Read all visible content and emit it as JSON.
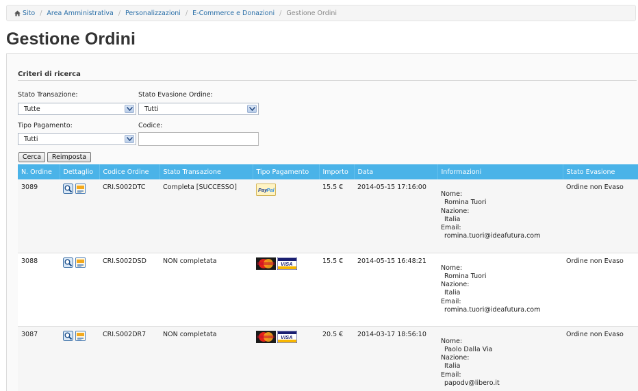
{
  "breadcrumb": {
    "items": [
      "Sito",
      "Area Amministrativa",
      "Personalizzazioni",
      "E-Commerce e Donazioni"
    ],
    "current": "Gestione Ordini"
  },
  "page": {
    "title": "Gestione Ordini"
  },
  "search": {
    "title": "Criteri di ricerca",
    "stato_transazione": {
      "label": "Stato Transazione:",
      "value": "Tutte"
    },
    "stato_evasione": {
      "label": "Stato Evasione Ordine:",
      "value": "Tutti"
    },
    "tipo_pagamento": {
      "label": "Tipo Pagamento:",
      "value": "Tutti"
    },
    "codice": {
      "label": "Codice:",
      "value": ""
    },
    "cerca_label": "Cerca",
    "reimposta_label": "Reimposta"
  },
  "table": {
    "headers": [
      "N. Ordine",
      "Dettaglio",
      "Codice Ordine",
      "Stato Transazione",
      "Tipo Pagamento",
      "Importo",
      "Data",
      "Informazioni",
      "Stato Evasione"
    ],
    "info_labels": {
      "nome": "Nome:",
      "nazione": "Nazione:",
      "email": "Email:"
    },
    "rows": [
      {
        "numero": "3089",
        "codice": "CRI.S002DTC",
        "stato": "Completa [SUCCESSO]",
        "pagamento": "paypal",
        "importo": "15.5 €",
        "data": "2014-05-15 17:16:00",
        "nome": "Romina Tuori",
        "nazione": "Italia",
        "email": "romina.tuori@ideafutura.com",
        "evasione": "Ordine non Evaso"
      },
      {
        "numero": "3088",
        "codice": "CRI.S002DSD",
        "stato": "NON completata",
        "pagamento": "card",
        "importo": "15.5 €",
        "data": "2014-05-15 16:48:21",
        "nome": "Romina Tuori",
        "nazione": "Italia",
        "email": "romina.tuori@ideafutura.com",
        "evasione": "Ordine non Evaso"
      },
      {
        "numero": "3087",
        "codice": "CRI.S002DR7",
        "stato": "NON completata",
        "pagamento": "card",
        "importo": "20.5 €",
        "data": "2014-03-17 18:56:10",
        "nome": "Paolo Dalla Via",
        "nazione": "Italia",
        "email": "papodv@libero.it",
        "evasione": "Ordine non Evaso"
      }
    ]
  },
  "colors": {
    "header_bg": "#4ab3e8",
    "link": "#2a6fa8"
  }
}
